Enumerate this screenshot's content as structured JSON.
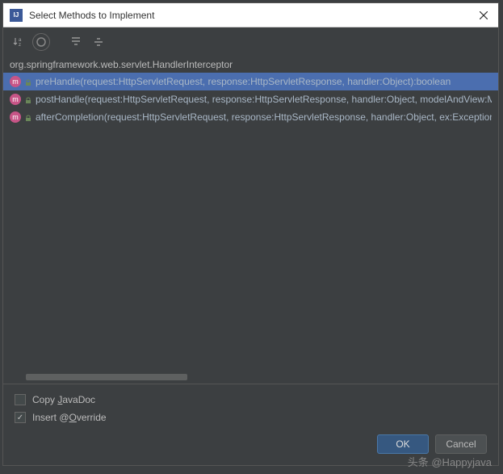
{
  "dialog": {
    "title": "Select Methods to Implement"
  },
  "classname": "org.springframework.web.servlet.HandlerInterceptor",
  "methods": [
    {
      "signature": "preHandle(request:HttpServletRequest, response:HttpServletResponse, handler:Object):boolean",
      "selected": true
    },
    {
      "signature": "postHandle(request:HttpServletRequest, response:HttpServletResponse, handler:Object, modelAndView:ModelAndView):Unit",
      "selected": false
    },
    {
      "signature": "afterCompletion(request:HttpServletRequest, response:HttpServletResponse, handler:Object, ex:Exception):Unit",
      "selected": false
    }
  ],
  "checkboxes": {
    "copy_javadoc": {
      "label_pre": "Copy ",
      "mnemonic": "J",
      "label_post": "avaDoc",
      "checked": false
    },
    "insert_override": {
      "label_pre": "Insert @",
      "mnemonic": "O",
      "label_post": "verride",
      "checked": true
    }
  },
  "buttons": {
    "ok": "OK",
    "cancel": "Cancel"
  },
  "watermark": "头条 @Happyjava"
}
